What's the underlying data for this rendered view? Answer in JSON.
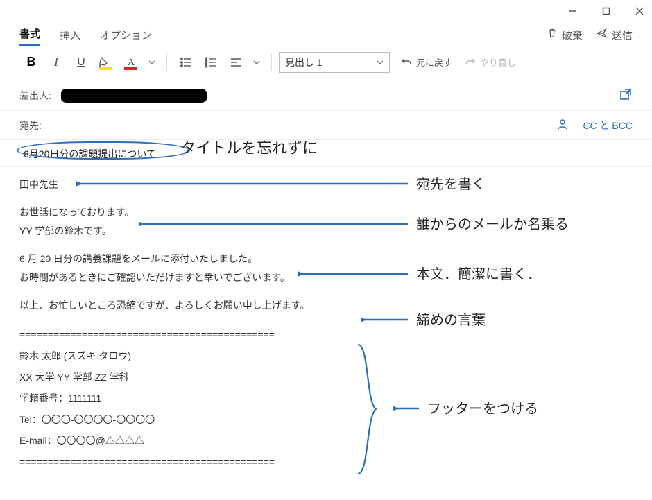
{
  "window": {
    "minimize": "−",
    "maximize": "▢",
    "close": "✕"
  },
  "tabs": {
    "items": [
      "書式",
      "挿入",
      "オプション"
    ],
    "active_index": 0
  },
  "top_actions": {
    "discard": "破棄",
    "send": "送信"
  },
  "toolbar": {
    "bold": "B",
    "italic": "I",
    "underline": "U",
    "style_select": "見出し 1",
    "undo": "元に戻す",
    "redo": "やり直し"
  },
  "fields": {
    "from_label": "差出人:",
    "to_label": "宛先:",
    "cc_bcc": "CC と BCC"
  },
  "subject": "6月20日分の課題提出について",
  "body": {
    "salutation": "田中先生",
    "intro1": "お世話になっております。",
    "intro2": "YY 学部の鈴木です。",
    "main1": "6 月 20 日分の講義課題をメールに添付いたしました。",
    "main2": "お時間があるときにご確認いただけますと幸いでございます。",
    "closing": "以上、お忙しいところ恐縮ですが、よろしくお願い申し上げます。"
  },
  "signature": {
    "divider": "=============================================",
    "name": "鈴木 太郎 (スズキ タロウ)",
    "affiliation": "XX 大学 YY 学部 ZZ 学科",
    "student_id": "学籍番号：1111111",
    "tel": "Tel：〇〇〇-〇〇〇〇-〇〇〇〇",
    "email": "E-mail：〇〇〇〇@△△△△"
  },
  "annotations": {
    "title": "タイトルを忘れずに",
    "to": "宛先を書く",
    "intro": "誰からのメールか名乗る",
    "body": "本文．簡潔に書く．",
    "closing": "締めの言葉",
    "footer": "フッターをつける"
  },
  "colors": {
    "accent": "#2a6fbe",
    "highlight": "#ffe600",
    "fontcolor": "#d22"
  }
}
